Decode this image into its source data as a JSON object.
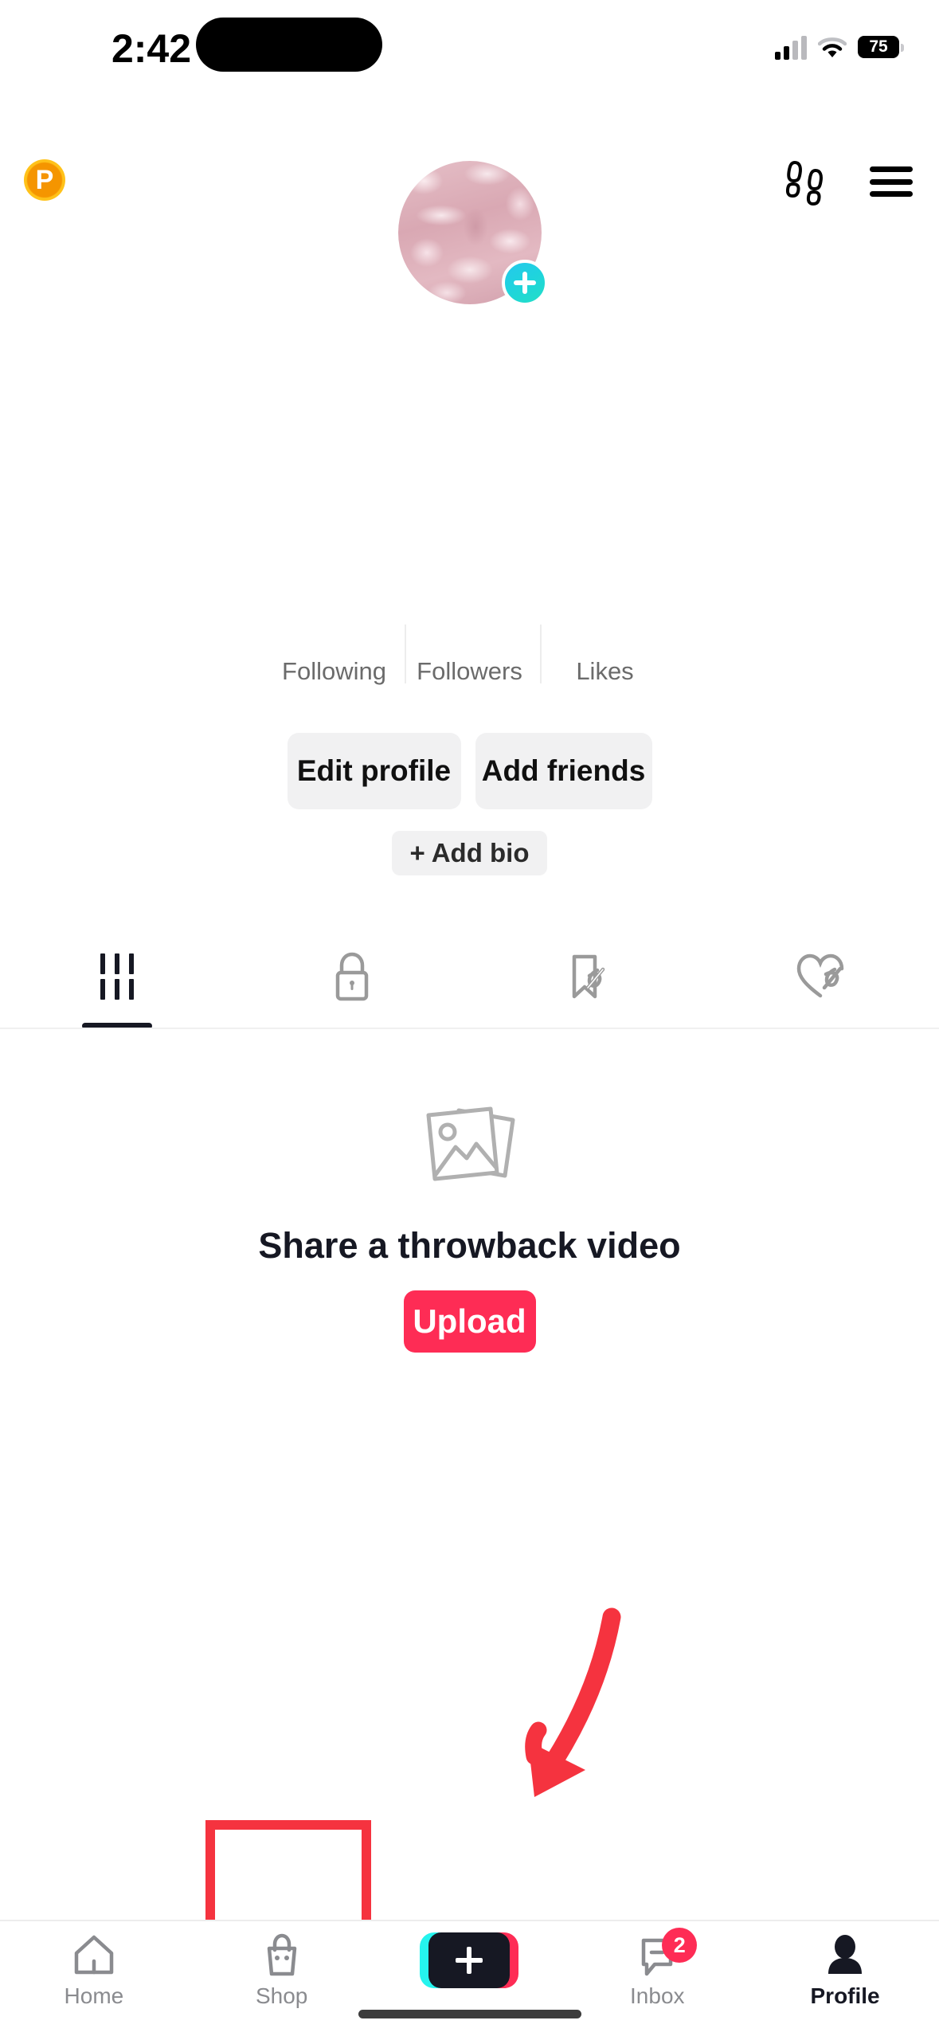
{
  "status_bar": {
    "time": "2:42",
    "battery_level": "75",
    "icons": [
      "cellular-signal-icon",
      "wifi-icon",
      "battery-icon"
    ]
  },
  "top_bar": {
    "coin_badge_label": "P",
    "footprints_icon": "footprints-icon",
    "menu_icon": "hamburger-menu-icon"
  },
  "profile": {
    "avatar_alt": "pink water ripple profile photo",
    "add_story_icon": "plus-icon",
    "username": "",
    "stats": [
      {
        "value": "",
        "label": "Following"
      },
      {
        "value": "",
        "label": "Followers"
      },
      {
        "value": "",
        "label": "Likes"
      }
    ],
    "buttons": {
      "edit_profile": "Edit profile",
      "add_friends": "Add friends",
      "add_bio": "+ Add bio"
    }
  },
  "content_tabs": [
    {
      "name": "videos",
      "icon": "grid-icon",
      "active": true
    },
    {
      "name": "private",
      "icon": "lock-icon",
      "active": false
    },
    {
      "name": "reposts",
      "icon": "bookmark-slash-icon",
      "active": false
    },
    {
      "name": "liked",
      "icon": "heart-slash-icon",
      "active": false
    }
  ],
  "empty_state": {
    "icon": "photo-stack-icon",
    "title": "Share a throwback video",
    "button_label": "Upload"
  },
  "annotation": {
    "arrow_color": "#F5333F",
    "highlight_color": "#F5333F",
    "target": "create-button"
  },
  "bottom_nav": [
    {
      "label": "Home",
      "icon": "home-icon",
      "active": false
    },
    {
      "label": "Shop",
      "icon": "shopping-bag-icon",
      "active": false
    },
    {
      "label": "",
      "icon": "create-plus-icon",
      "active": false
    },
    {
      "label": "Inbox",
      "icon": "message-icon",
      "badge": "2",
      "active": false
    },
    {
      "label": "Profile",
      "icon": "person-icon",
      "active": true
    }
  ],
  "colors": {
    "tiktok_red": "#FE2C55",
    "tiktok_cyan": "#25F4EE",
    "dark": "#161823",
    "gray_button": "#F1F1F2",
    "annotation_red": "#F5333F"
  }
}
